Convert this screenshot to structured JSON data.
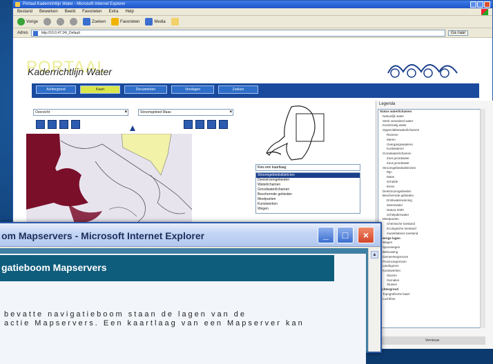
{
  "back_window": {
    "title": "Portaal Kaderrichtlijn Water - Microsoft Internet Explorer",
    "menu": [
      "Bestand",
      "Bewerken",
      "Beeld",
      "Favorieten",
      "Extra",
      "Help"
    ],
    "toolbar": [
      "Vorige",
      "",
      "",
      "",
      "Zoeken",
      "Favorieten",
      "Media",
      ""
    ],
    "address_label": "Adres",
    "address_value": "http://10.0.47.24/_Default",
    "go_label": "Ga naar"
  },
  "portal": {
    "title": "PORTAAL",
    "subtitle": "Kaderrichtlijn Water",
    "nav": [
      "Achtergrond",
      "Kaart",
      "Documenten",
      "Verslagen",
      "Zoeken"
    ],
    "select_left": "Overzicht",
    "select_right": "Stroomgebied Maas",
    "layer_select": "Kies een kaartlaag",
    "layers": [
      "Stroomgebiedsdistricten",
      "Deelstroomgebieden",
      "Waterlichamen",
      "Grondwaterlichamen",
      "Beschermde gebieden",
      "Meetpunten",
      "Kunstwerken",
      "Wegen"
    ],
    "legend_title": "Legenda",
    "legend_rows": [
      {
        "text": "Status waterlichamen",
        "type": "head"
      },
      {
        "text": "Natuurlijk water",
        "type": "row"
      },
      {
        "text": "Sterk veranderd water",
        "type": "row"
      },
      {
        "text": "Kunstmatig water",
        "type": "row"
      },
      {
        "text": "Oppervlaktewaterlichamen",
        "type": "row"
      },
      {
        "text": "Rivieren",
        "type": "indent"
      },
      {
        "text": "Meren",
        "type": "indent"
      },
      {
        "text": "Overgangswateren",
        "type": "indent"
      },
      {
        "text": "Kustwateren",
        "type": "indent"
      },
      {
        "text": "Grondwaterlichamen",
        "type": "row"
      },
      {
        "text": "Zoet grondwater",
        "type": "indent"
      },
      {
        "text": "Zout grondwater",
        "type": "indent"
      },
      {
        "text": "Stroomgebiedsdistricten",
        "type": "row"
      },
      {
        "text": "Rijn",
        "type": "indent"
      },
      {
        "text": "Maas",
        "type": "indent"
      },
      {
        "text": "Schelde",
        "type": "indent"
      },
      {
        "text": "Eems",
        "type": "indent"
      },
      {
        "text": "Deelstroomgebieden",
        "type": "row"
      },
      {
        "text": "Beschermde gebieden",
        "type": "row"
      },
      {
        "text": "Drinkwaterwinning",
        "type": "indent"
      },
      {
        "text": "Zwemwater",
        "type": "indent"
      },
      {
        "text": "Natura 2000",
        "type": "indent"
      },
      {
        "text": "Schelpdierwater",
        "type": "indent"
      },
      {
        "text": "Meetpunten",
        "type": "row"
      },
      {
        "text": "Chemische toestand",
        "type": "indent"
      },
      {
        "text": "Ecologische toestand",
        "type": "indent"
      },
      {
        "text": "Kwantitatieve toestand",
        "type": "indent"
      },
      {
        "text": "Overige lagen",
        "type": "head"
      },
      {
        "text": "Wegen",
        "type": "row"
      },
      {
        "text": "Spoorwegen",
        "type": "row"
      },
      {
        "text": "Bebouwing",
        "type": "row"
      },
      {
        "text": "Gemeentegrenzen",
        "type": "row"
      },
      {
        "text": "Provinciegrenzen",
        "type": "row"
      },
      {
        "text": "Landsgrens",
        "type": "row"
      },
      {
        "text": "Kunstwerken",
        "type": "row"
      },
      {
        "text": "Sluizen",
        "type": "indent"
      },
      {
        "text": "Gemalen",
        "type": "indent"
      },
      {
        "text": "Stuwen",
        "type": "indent"
      },
      {
        "text": "Achtergrond",
        "type": "head"
      },
      {
        "text": "Topografische kaart",
        "type": "row"
      },
      {
        "text": "Luchtfoto",
        "type": "row"
      }
    ],
    "legend_footer": "Vernieuw"
  },
  "front_window": {
    "title": "om Mapservers - Microsoft Internet Explorer",
    "heading": "gatieboom Mapservers",
    "body_line1": "bevatte   navigatieboom   staan   de   lagen   van   de",
    "body_line2": "actie Mapservers. Een kaartlaag van een Mapserver kan"
  }
}
